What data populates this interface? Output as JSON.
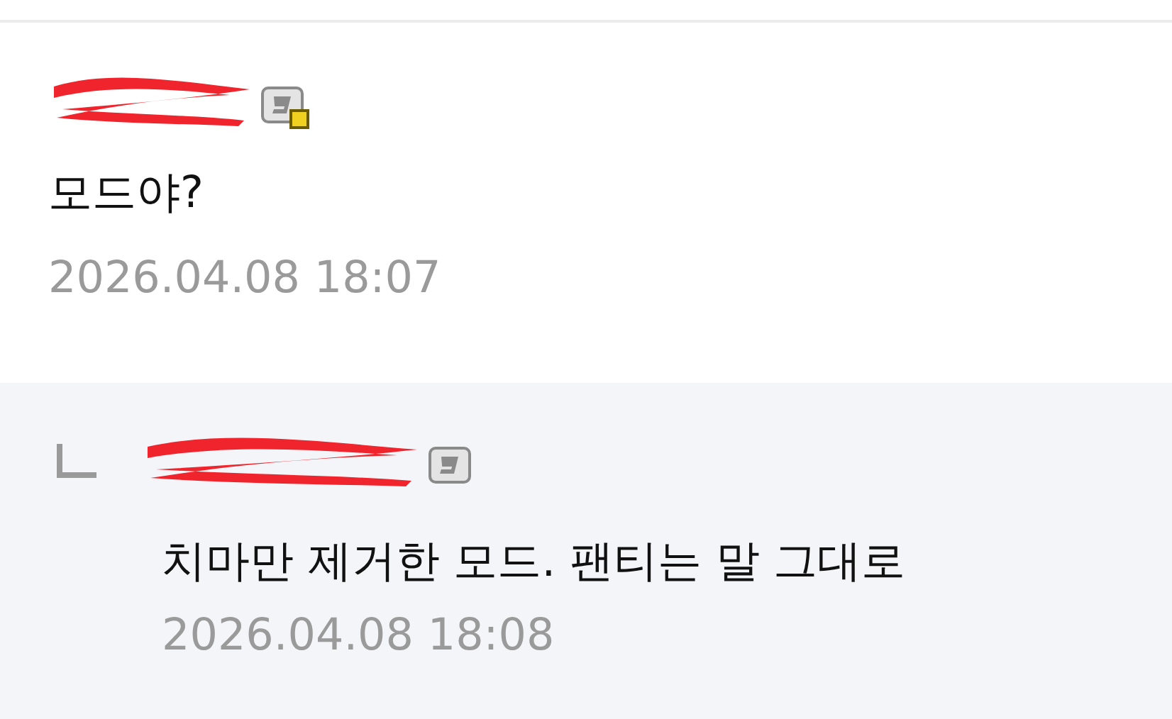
{
  "comments": [
    {
      "text": "모드야?",
      "time": "2026.04.08 18:07",
      "icon_marked": true,
      "children": [
        {
          "text": "치마만 제거한 모드. 팬티는 말 그대로",
          "time": "2026.04.08 18:08",
          "icon_marked": false
        }
      ]
    }
  ]
}
